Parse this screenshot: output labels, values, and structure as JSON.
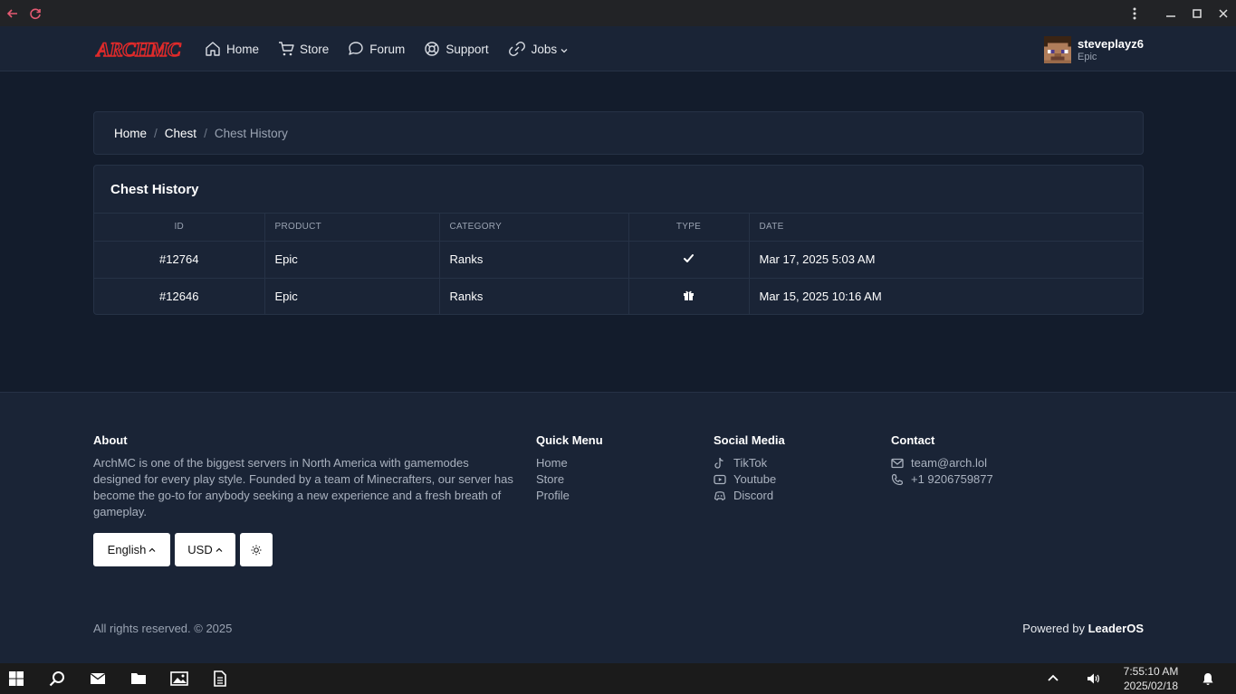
{
  "site": {
    "logo_text": "ARCHMC",
    "nav": [
      {
        "label": "Home",
        "icon": "home-icon"
      },
      {
        "label": "Store",
        "icon": "cart-icon"
      },
      {
        "label": "Forum",
        "icon": "chat-icon"
      },
      {
        "label": "Support",
        "icon": "lifebuoy-icon"
      },
      {
        "label": "Jobs",
        "icon": "link-icon"
      }
    ],
    "user": {
      "name": "steveplayz6",
      "rank": "Epic"
    }
  },
  "breadcrumb": {
    "items": [
      "Home",
      "Chest",
      "Chest History"
    ],
    "separator": "/"
  },
  "history": {
    "title": "Chest History",
    "columns": [
      "ID",
      "PRODUCT",
      "CATEGORY",
      "TYPE",
      "DATE"
    ],
    "rows": [
      {
        "id": "#12764",
        "product": "Epic",
        "category": "Ranks",
        "type": "check-icon",
        "date": "Mar 17, 2025 5:03 AM"
      },
      {
        "id": "#12646",
        "product": "Epic",
        "category": "Ranks",
        "type": "gift-icon",
        "date": "Mar 15, 2025 10:16 AM"
      }
    ]
  },
  "footer": {
    "about": {
      "title": "About",
      "text": "ArchMC is one of the biggest servers in North America with gamemodes designed for every play style. Founded by a team of Minecrafters, our server has become the go-to for anybody seeking a new experience and a fresh breath of gameplay."
    },
    "quick_menu": {
      "title": "Quick Menu",
      "links": [
        "Home",
        "Store",
        "Profile"
      ]
    },
    "social": {
      "title": "Social Media",
      "links": [
        {
          "label": "TikTok",
          "icon": "tiktok-icon"
        },
        {
          "label": "Youtube",
          "icon": "youtube-icon"
        },
        {
          "label": "Discord",
          "icon": "discord-icon"
        }
      ]
    },
    "contact": {
      "title": "Contact",
      "email": "team@arch.lol",
      "phone": "+1 9206759877"
    },
    "language_label": "English",
    "currency_label": "USD",
    "copyright": "All rights reserved. © 2025",
    "powered_prefix": "Powered by",
    "powered_brand": "LeaderOS"
  },
  "taskbar": {
    "time": "7:55:10 AM",
    "date": "2025/02/18"
  },
  "colors": {
    "background": "#131c2c",
    "card": "#1a2436",
    "border": "#263246",
    "logo": "#e02a2a"
  }
}
